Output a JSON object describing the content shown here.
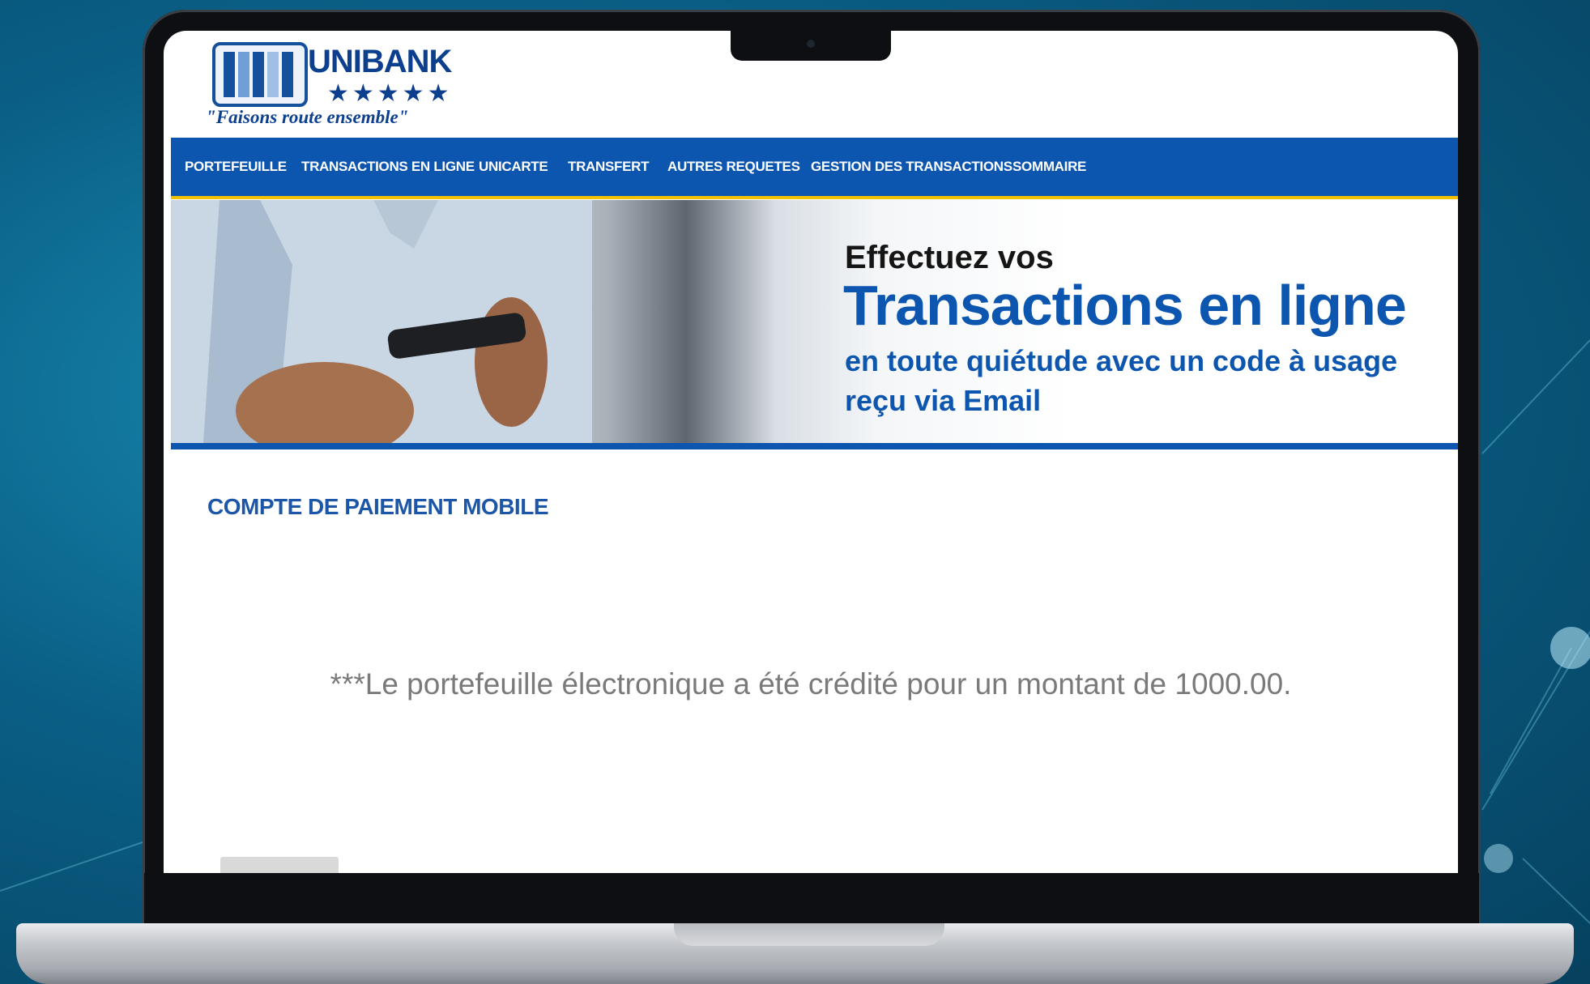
{
  "brand": {
    "name": "UNIBANK",
    "stars": "★★★★★",
    "tagline": "\"Faisons route ensemble\"",
    "color": "#0d3f8f"
  },
  "nav": {
    "items": [
      {
        "label": "PORTEFEUILLE"
      },
      {
        "label": "TRANSACTIONS EN LIGNE"
      },
      {
        "label": "UNICARTE"
      },
      {
        "label": "TRANSFERT"
      },
      {
        "label": "AUTRES REQUETES"
      },
      {
        "label": "GESTION DES TRANSACTIONS"
      },
      {
        "label": "SOMMAIRE"
      }
    ],
    "background": "#0d56b0",
    "accent": "#f2c200"
  },
  "banner": {
    "line1": "Effectuez vos",
    "line2": "Transactions en ligne",
    "line3": "en toute quiétude avec un code à usage",
    "line4": "reçu via Email"
  },
  "main": {
    "section_title": "COMPTE DE PAIEMENT MOBILE",
    "message": "***Le portefeuille électronique a été crédité pour un montant de 1000.00."
  }
}
